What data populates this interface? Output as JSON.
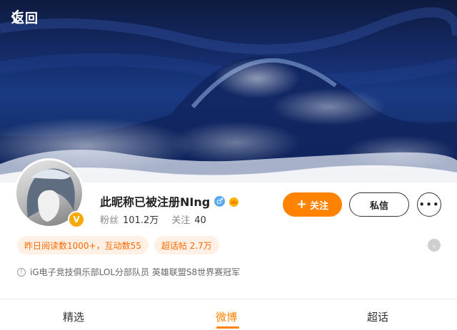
{
  "header": {
    "back_label": "返回",
    "back_icon": "chevron-left-icon"
  },
  "profile": {
    "name": "此昵称已被注册NIng",
    "gender_icon": "male-icon",
    "gender_glyph": "♂",
    "vip_icon": "crown-icon",
    "verified_badge": "V",
    "fans_label": "粉丝",
    "fans_value": "101.2万",
    "following_label": "关注",
    "following_value": "40"
  },
  "actions": {
    "follow_icon": "plus-icon",
    "follow_glyph": "+",
    "follow_label": "关注",
    "message_label": "私信",
    "more_icon": "more-icon",
    "more_glyph": "•••"
  },
  "tags": [
    {
      "label": "昨日阅读数1000+，互动数55"
    },
    {
      "label": "超话帖 2.7万"
    }
  ],
  "expand_glyph": "⌄",
  "bio": {
    "info_icon": "info-icon",
    "info_glyph": "!",
    "text": "iG电子竞技俱乐部LOL分部队员 英雄联盟S8世界赛冠军"
  },
  "tabs": [
    {
      "label": "精选",
      "active": false
    },
    {
      "label": "微博",
      "active": true
    },
    {
      "label": "超话",
      "active": false
    }
  ],
  "colors": {
    "accent": "#ff8200",
    "tag_bg": "#fff0e6",
    "tag_text": "#ff6a00",
    "verified": "#f7a900",
    "male": "#5aa9f0"
  }
}
